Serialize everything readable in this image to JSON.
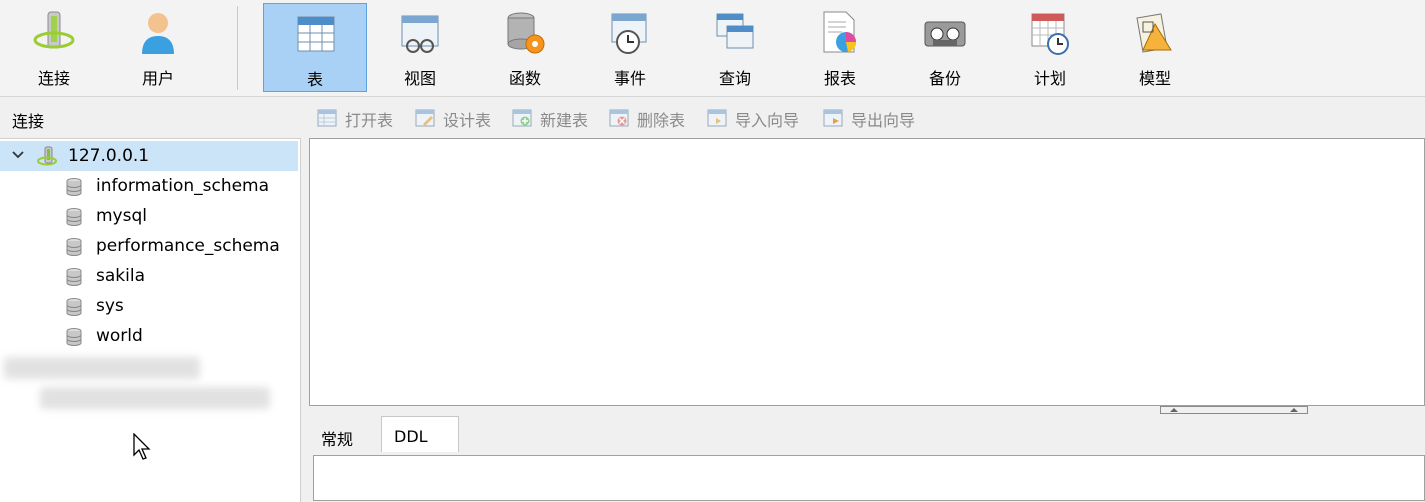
{
  "toolbar": {
    "items": [
      {
        "label": "连接",
        "icon": "connect-icon"
      },
      {
        "label": "用户",
        "icon": "user-icon"
      },
      {
        "label": "表",
        "icon": "table-icon",
        "active": true
      },
      {
        "label": "视图",
        "icon": "view-icon"
      },
      {
        "label": "函数",
        "icon": "function-icon"
      },
      {
        "label": "事件",
        "icon": "event-icon"
      },
      {
        "label": "查询",
        "icon": "query-icon"
      },
      {
        "label": "报表",
        "icon": "report-icon"
      },
      {
        "label": "备份",
        "icon": "backup-icon"
      },
      {
        "label": "计划",
        "icon": "schedule-icon"
      },
      {
        "label": "模型",
        "icon": "model-icon"
      }
    ]
  },
  "left_panel": {
    "header": "连接",
    "connection": "127.0.0.1",
    "databases": [
      "information_schema",
      "mysql",
      "performance_schema",
      "sakila",
      "sys",
      "world"
    ]
  },
  "object_toolbar": {
    "open": "打开表",
    "design": "设计表",
    "new": "新建表",
    "delete": "删除表",
    "import": "导入向导",
    "export": "导出向导"
  },
  "tabs": {
    "general": "常规",
    "ddl": "DDL"
  },
  "colors": {
    "accent_selected": "#a9d1f5",
    "tree_selected": "#cce4f7"
  }
}
